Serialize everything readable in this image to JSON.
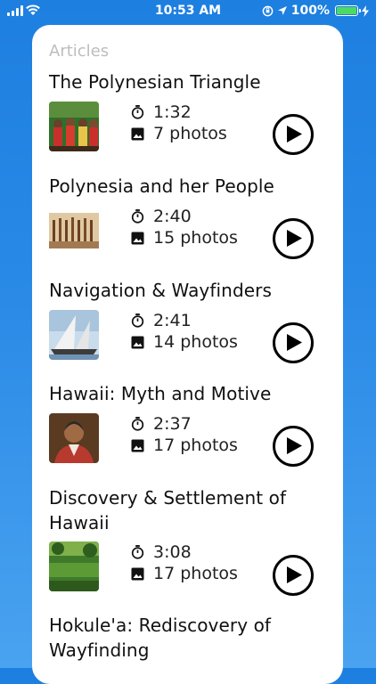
{
  "status_bar": {
    "time": "10:53 AM",
    "battery": "100%",
    "battery_level": 1.0
  },
  "section": {
    "title": "Articles"
  },
  "articles": [
    {
      "title": "The Polynesian Triangle",
      "duration": "1:32",
      "photos": "7 photos"
    },
    {
      "title": "Polynesia and her People",
      "duration": "2:40",
      "photos": "15 photos"
    },
    {
      "title": "Navigation & Wayfinders",
      "duration": "2:41",
      "photos": "14 photos"
    },
    {
      "title": "Hawaii: Myth and Motive",
      "duration": "2:37",
      "photos": "17 photos"
    },
    {
      "title": "Discovery & Settlement of Hawaii",
      "duration": "3:08",
      "photos": "17 photos"
    },
    {
      "title": "Hokule'a: Rediscovery of Wayfinding"
    }
  ],
  "colors": {
    "background": "#2a8ae6",
    "card": "#ffffff",
    "section_title": "#bdbdbd",
    "battery": "#4cd964"
  }
}
